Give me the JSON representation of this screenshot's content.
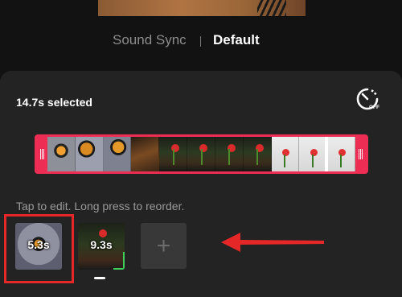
{
  "tabs": {
    "sound_sync": "Sound Sync",
    "default": "Default",
    "active": "Default"
  },
  "sheet": {
    "selected_text": "14.7s selected",
    "speed_icon_label": "OFF",
    "hint": "Tap to edit. Long press to reorder."
  },
  "timeline": {
    "frames": [
      "cat",
      "cat",
      "cat",
      "owl",
      "rose",
      "rose",
      "rose",
      "rose",
      "light",
      "light",
      "light"
    ],
    "playhead_fraction": 0.9
  },
  "clips": [
    {
      "duration": "5.3s",
      "selected": true
    },
    {
      "duration": "9.3s",
      "selected": false
    }
  ],
  "add_clip_symbol": "+",
  "colors": {
    "accent": "#ee2d55",
    "annotation": "#e62727",
    "background": "#121212",
    "sheet": "#232323"
  },
  "icons": {
    "speed": "speedometer-off-icon",
    "add": "plus-icon",
    "annotation": "arrow-left-icon"
  }
}
